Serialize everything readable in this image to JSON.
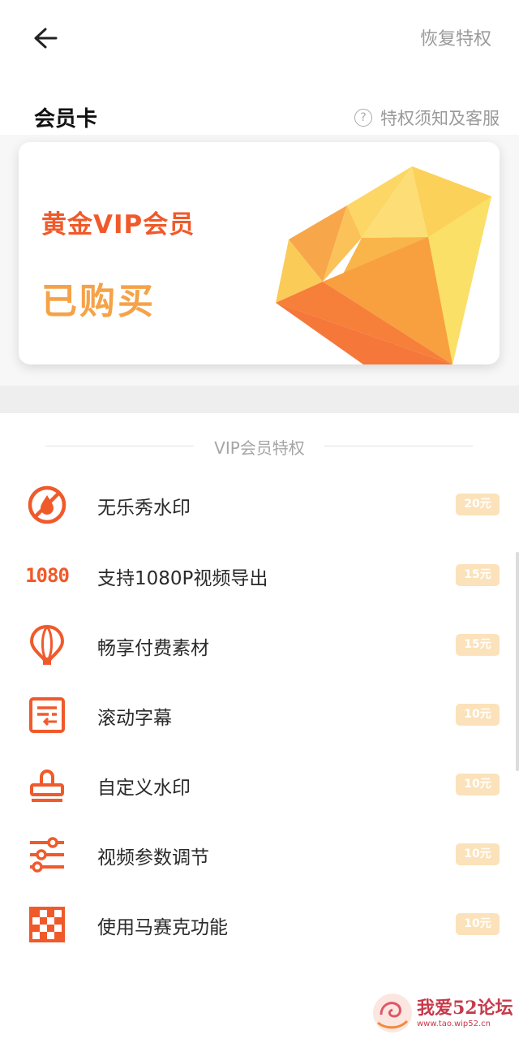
{
  "header": {
    "back_icon": "arrow-left-icon",
    "restore_label": "恢复特权"
  },
  "card_section": {
    "title": "会员卡",
    "help_label": "特权须知及客服",
    "card": {
      "name": "黄金VIP会员",
      "status": "已购买",
      "gem_icon": "diamond-icon"
    }
  },
  "privileges": {
    "title": "VIP会员特权",
    "items": [
      {
        "icon": "no-watermark-icon",
        "label": "无乐秀水印",
        "price": "20元"
      },
      {
        "icon": "1080-icon",
        "label": "支持1080P视频导出",
        "price": "15元"
      },
      {
        "icon": "balloon-icon",
        "label": "畅享付费素材",
        "price": "15元"
      },
      {
        "icon": "subtitle-icon",
        "label": "滚动字幕",
        "price": "10元"
      },
      {
        "icon": "stamp-icon",
        "label": "自定义水印",
        "price": "10元"
      },
      {
        "icon": "sliders-icon",
        "label": "视频参数调节",
        "price": "10元"
      },
      {
        "icon": "mosaic-icon",
        "label": "使用马赛克功能",
        "price": "10元"
      }
    ],
    "icon_text_1080": "1080"
  },
  "watermark": {
    "text": "我爱52论坛",
    "url": "www.tao.wip52.cn"
  },
  "colors": {
    "accent": "#f05a2b",
    "status": "#f5a248",
    "price_badge": "#fbe2ba",
    "muted": "#9a9a9a"
  }
}
